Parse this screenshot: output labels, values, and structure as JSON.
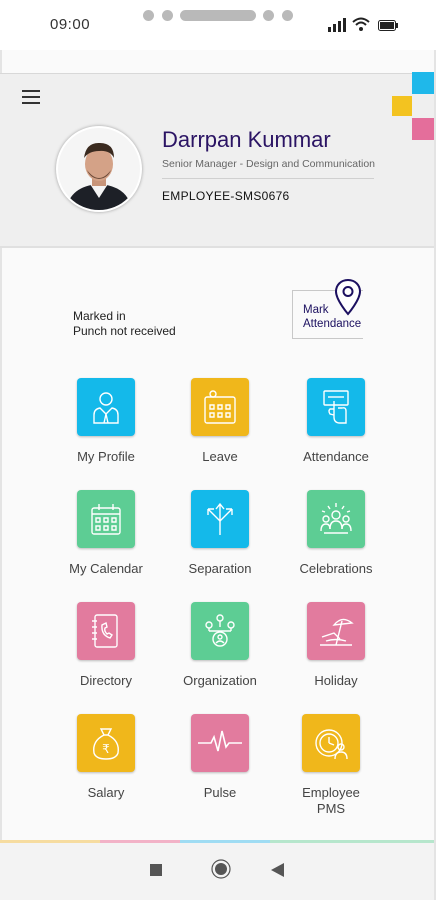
{
  "status_bar": {
    "time": "09:00"
  },
  "header": {
    "name": "Darrpan Kummar",
    "designation": "Senior Manager - Design and Communication",
    "employee_id": "EMPLOYEE-SMS0676",
    "menu_icon": "hamburger-icon",
    "deco_colors": [
      "#f3c320",
      "#1fb8ea",
      "#e46e9b"
    ]
  },
  "attendance": {
    "status_line1": "Marked in",
    "status_line2": "Punch not received",
    "mark_line1": "Mark",
    "mark_line2": "Attendance",
    "mark_icon": "location-pin-icon"
  },
  "tiles": [
    {
      "label": "My Profile",
      "icon": "profile-icon",
      "color": "#14b9ea"
    },
    {
      "label": "Leave",
      "icon": "leave-icon",
      "color": "#f0b71b"
    },
    {
      "label": "Attendance",
      "icon": "attendance-icon",
      "color": "#14b9ea"
    },
    {
      "label": "My Calendar",
      "icon": "calendar-icon",
      "color": "#5dcd94"
    },
    {
      "label": "Separation",
      "icon": "separation-icon",
      "color": "#14b9ea"
    },
    {
      "label": "Celebrations",
      "icon": "celebrations-icon",
      "color": "#5dcd94"
    },
    {
      "label": "Directory",
      "icon": "directory-icon",
      "color": "#e27b9e"
    },
    {
      "label": "Organization",
      "icon": "organization-icon",
      "color": "#5dcd94"
    },
    {
      "label": "Holiday",
      "icon": "holiday-icon",
      "color": "#e27b9e"
    },
    {
      "label": "Salary",
      "icon": "salary-icon",
      "color": "#f0b71b"
    },
    {
      "label": "Pulse",
      "icon": "pulse-icon",
      "color": "#e27b9e"
    },
    {
      "label_line1": "Employee",
      "label_line2": "PMS",
      "icon": "pms-icon",
      "color": "#f0b71b"
    }
  ]
}
